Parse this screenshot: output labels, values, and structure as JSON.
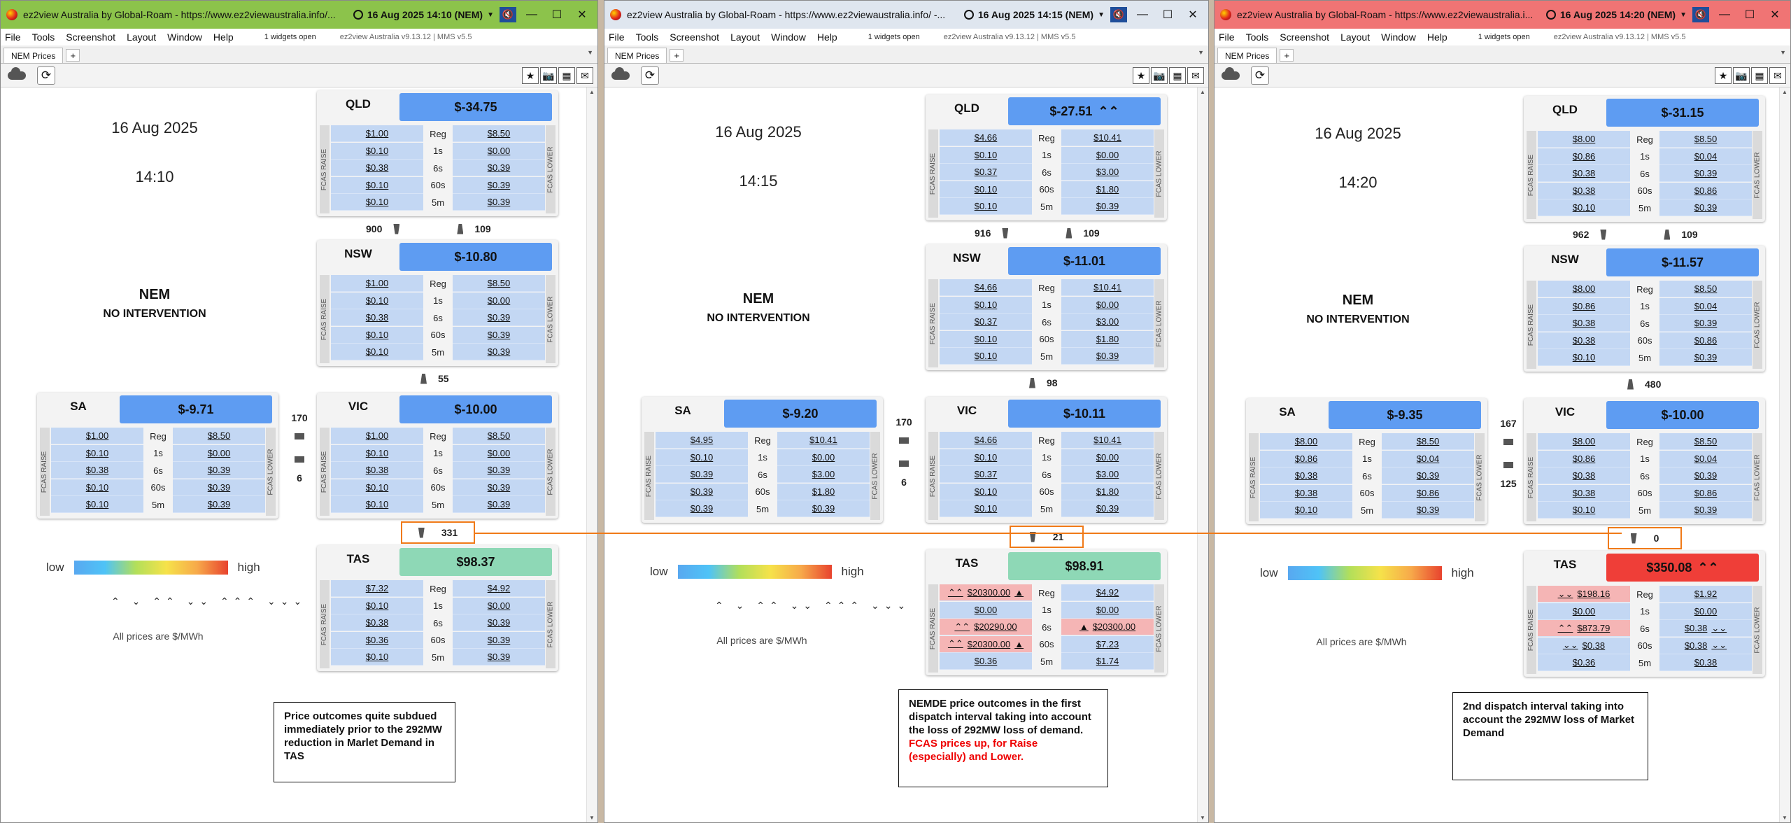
{
  "windows": [
    {
      "titlebar": {
        "title": "ez2view Australia by Global-Roam - https://www.ez2viewaustralia.info/...",
        "clock": "16 Aug 2025  14:10 (NEM)",
        "color": "#8cc34b"
      },
      "menubar": {
        "items": [
          "File",
          "Tools",
          "Screenshot",
          "Layout",
          "Window",
          "Help"
        ],
        "note": "1 widgets open",
        "version": "ez2view Australia v9.13.12 | MMS v5.5"
      },
      "tab": "NEM Prices",
      "left": {
        "date": "16 Aug 2025",
        "time": "14:10",
        "market": "NEM",
        "intervention": "NO INTERVENTION",
        "legend_low": "low",
        "legend_high": "high",
        "arrows": "⌃ ⌄ ⌃⌃ ⌄⌄ ⌃⌃⌃ ⌄⌄⌄",
        "units": "All prices are $/MWh"
      },
      "regions": {
        "qld": {
          "name": "QLD",
          "price": "$-34.75",
          "raise": [
            "$1.00",
            "$0.10",
            "$0.38",
            "$0.10",
            "$0.10"
          ],
          "lower": [
            "$8.50",
            "$0.00",
            "$0.39",
            "$0.39",
            "$0.39"
          ]
        },
        "nsw": {
          "name": "NSW",
          "price": "$-10.80",
          "raise": [
            "$1.00",
            "$0.10",
            "$0.38",
            "$0.10",
            "$0.10"
          ],
          "lower": [
            "$8.50",
            "$0.00",
            "$0.39",
            "$0.39",
            "$0.39"
          ]
        },
        "sa": {
          "name": "SA",
          "price": "$-9.71",
          "raise": [
            "$1.00",
            "$0.10",
            "$0.38",
            "$0.10",
            "$0.10"
          ],
          "lower": [
            "$8.50",
            "$0.00",
            "$0.39",
            "$0.39",
            "$0.39"
          ]
        },
        "vic": {
          "name": "VIC",
          "price": "$-10.00",
          "raise": [
            "$1.00",
            "$0.10",
            "$0.38",
            "$0.10",
            "$0.10"
          ],
          "lower": [
            "$8.50",
            "$0.00",
            "$0.39",
            "$0.39",
            "$0.39"
          ]
        },
        "tas": {
          "name": "TAS",
          "price": "$98.37",
          "raise": [
            "$7.32",
            "$0.10",
            "$0.38",
            "$0.36",
            "$0.10"
          ],
          "lower": [
            "$4.92",
            "$0.00",
            "$0.39",
            "$0.39",
            "$0.39"
          ]
        }
      },
      "flows": {
        "qld_nsw_a": "900",
        "qld_nsw_b": "109",
        "nsw_vic": "55",
        "sa_vic_a": "170",
        "sa_vic_b": "6",
        "vic_tas": "331"
      },
      "annotation": "Price outcomes quite subdued immediately prior to the 292MW reduction in Marlet Demand in TAS"
    },
    {
      "titlebar": {
        "title": "ez2view Australia by Global-Roam - https://www.ez2viewaustralia.info/ -...",
        "clock": "16 Aug 2025  14:15 (NEM)",
        "color": "#dfe6ef"
      },
      "menubar": {
        "items": [
          "File",
          "Tools",
          "Screenshot",
          "Layout",
          "Window",
          "Help"
        ],
        "note": "1 widgets open",
        "version": "ez2view Australia v9.13.12 | MMS v5.5"
      },
      "tab": "NEM Prices",
      "left": {
        "date": "16 Aug 2025",
        "time": "14:15",
        "market": "NEM",
        "intervention": "NO INTERVENTION",
        "legend_low": "low",
        "legend_high": "high",
        "arrows": "⌃ ⌄ ⌃⌃ ⌄⌄ ⌃⌃⌃ ⌄⌄⌄",
        "units": "All prices are $/MWh"
      },
      "regions": {
        "qld": {
          "name": "QLD",
          "price": "$-27.51",
          "raise": [
            "$4.66",
            "$0.10",
            "$0.37",
            "$0.10",
            "$0.10"
          ],
          "lower": [
            "$10.41",
            "$0.00",
            "$3.00",
            "$1.80",
            "$0.39"
          ]
        },
        "nsw": {
          "name": "NSW",
          "price": "$-11.01",
          "raise": [
            "$4.66",
            "$0.10",
            "$0.37",
            "$0.10",
            "$0.10"
          ],
          "lower": [
            "$10.41",
            "$0.00",
            "$3.00",
            "$1.80",
            "$0.39"
          ]
        },
        "sa": {
          "name": "SA",
          "price": "$-9.20",
          "raise": [
            "$4.95",
            "$0.10",
            "$0.39",
            "$0.39",
            "$0.39"
          ],
          "lower": [
            "$10.41",
            "$0.00",
            "$3.00",
            "$1.80",
            "$0.39"
          ]
        },
        "vic": {
          "name": "VIC",
          "price": "$-10.11",
          "raise": [
            "$4.66",
            "$0.10",
            "$0.37",
            "$0.10",
            "$0.10"
          ],
          "lower": [
            "$10.41",
            "$0.00",
            "$3.00",
            "$1.80",
            "$0.39"
          ]
        },
        "tas": {
          "name": "TAS",
          "price": "$98.91",
          "raise": [
            "$20300.00",
            "$0.00",
            "$20290.00",
            "$20300.00",
            "$0.36"
          ],
          "lower": [
            "$4.92",
            "$0.00",
            "$20300.00",
            "$7.23",
            "$1.74"
          ]
        }
      },
      "flows": {
        "qld_nsw_a": "916",
        "qld_nsw_b": "109",
        "nsw_vic": "98",
        "sa_vic_a": "170",
        "sa_vic_b": "6",
        "vic_tas": "21"
      },
      "annotation": "NEMDE price outcomes in the first dispatch interval taking into account the loss of 292MW loss of demand.",
      "annotation_red": "FCAS prices up, for Raise (especially) and Lower."
    },
    {
      "titlebar": {
        "title": "ez2view Australia by Global-Roam - https://www.ez2viewaustralia.i...",
        "clock": "16 Aug 2025  14:20 (NEM)",
        "color": "#f07474"
      },
      "menubar": {
        "items": [
          "File",
          "Tools",
          "Screenshot",
          "Layout",
          "Window",
          "Help"
        ],
        "note": "1 widgets open",
        "version": "ez2view Australia v9.13.12 | MMS v5.5"
      },
      "tab": "NEM Prices",
      "left": {
        "date": "16 Aug 2025",
        "time": "14:20",
        "market": "NEM",
        "intervention": "NO INTERVENTION",
        "legend_low": "low",
        "legend_high": "high",
        "arrows": "",
        "units": "All prices are $/MWh"
      },
      "regions": {
        "qld": {
          "name": "QLD",
          "price": "$-31.15",
          "raise": [
            "$8.00",
            "$0.86",
            "$0.38",
            "$0.38",
            "$0.10"
          ],
          "lower": [
            "$8.50",
            "$0.04",
            "$0.39",
            "$0.86",
            "$0.39"
          ]
        },
        "nsw": {
          "name": "NSW",
          "price": "$-11.57",
          "raise": [
            "$8.00",
            "$0.86",
            "$0.38",
            "$0.38",
            "$0.10"
          ],
          "lower": [
            "$8.50",
            "$0.04",
            "$0.39",
            "$0.86",
            "$0.39"
          ]
        },
        "sa": {
          "name": "SA",
          "price": "$-9.35",
          "raise": [
            "$8.00",
            "$0.86",
            "$0.38",
            "$0.38",
            "$0.10"
          ],
          "lower": [
            "$8.50",
            "$0.04",
            "$0.39",
            "$0.86",
            "$0.39"
          ]
        },
        "vic": {
          "name": "VIC",
          "price": "$-10.00",
          "raise": [
            "$8.00",
            "$0.86",
            "$0.38",
            "$0.38",
            "$0.10"
          ],
          "lower": [
            "$8.50",
            "$0.04",
            "$0.39",
            "$0.86",
            "$0.39"
          ]
        },
        "tas": {
          "name": "TAS",
          "price": "$350.08",
          "raise": [
            "$198.16",
            "$0.00",
            "$873.79",
            "$0.38",
            "$0.36"
          ],
          "lower": [
            "$1.92",
            "$0.00",
            "$0.38",
            "$0.38",
            "$0.38"
          ]
        }
      },
      "flows": {
        "qld_nsw_a": "962",
        "qld_nsw_b": "109",
        "nsw_vic": "480",
        "sa_vic_a": "167",
        "sa_vic_b": "125",
        "vic_tas": "0"
      },
      "annotation": "2nd dispatch interval taking into account the 292MW loss of Market Demand"
    }
  ],
  "fcas_labels": [
    "Reg",
    "1s",
    "6s",
    "60s",
    "5m"
  ],
  "side_labels": {
    "raise": "FCAS RAISE",
    "lower": "FCAS LOWER"
  },
  "colors": {
    "price_blue": "#5e9cf2",
    "price_green": "#8ed8b6",
    "price_red": "#ef3e38",
    "fcas_blue": "#c3d7f3",
    "fcas_red": "#f5b5b5",
    "highlight": "#f07a18"
  }
}
